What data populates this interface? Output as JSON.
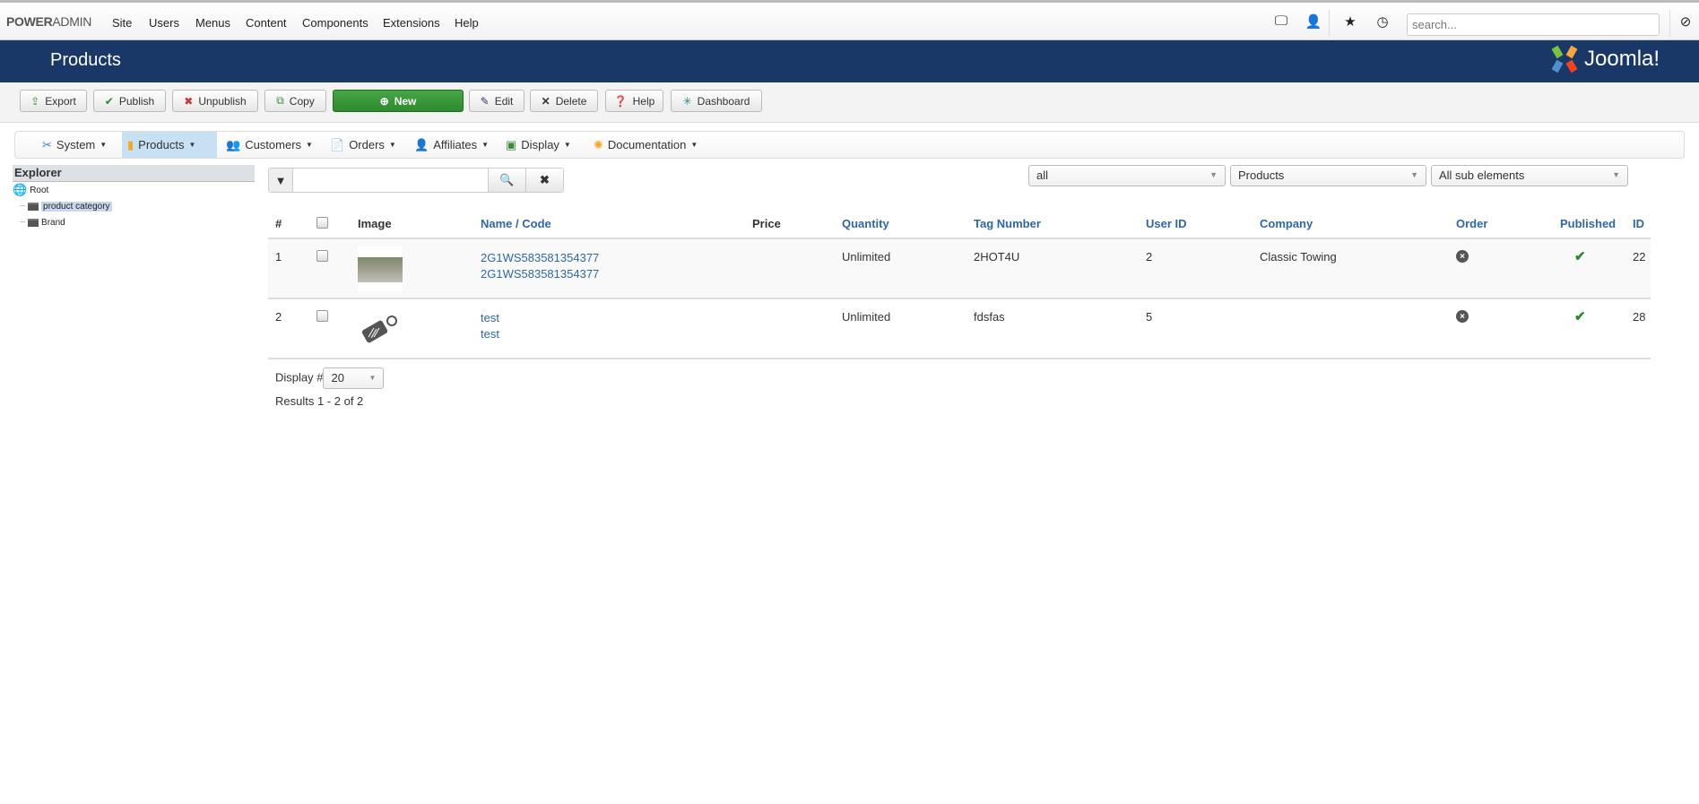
{
  "topnav": {
    "brand_bold": "POWER",
    "brand_rest": "ADMIN",
    "items": [
      "Site",
      "Users",
      "Menus",
      "Content",
      "Components",
      "Extensions",
      "Help"
    ],
    "search_placeholder": "search..."
  },
  "title": "Products",
  "logo_text": "Joomla!",
  "toolbar": {
    "export": "Export",
    "publish": "Publish",
    "unpublish": "Unpublish",
    "copy": "Copy",
    "new": "New",
    "edit": "Edit",
    "delete": "Delete",
    "help": "Help",
    "dashboard": "Dashboard"
  },
  "submenu": [
    "System",
    "Products",
    "Customers",
    "Orders",
    "Affiliates",
    "Display",
    "Documentation"
  ],
  "explorer": {
    "title": "Explorer",
    "root": "Root",
    "children": [
      "product category",
      "Brand"
    ]
  },
  "filters": {
    "status": "all",
    "type": "Products",
    "scope": "All sub elements"
  },
  "table": {
    "headers": {
      "num": "#",
      "image": "Image",
      "name": "Name / Code",
      "price": "Price",
      "quantity": "Quantity",
      "tag": "Tag Number",
      "user": "User ID",
      "company": "Company",
      "order": "Order",
      "published": "Published",
      "id": "ID"
    },
    "rows": [
      {
        "num": "1",
        "name": "2G1WS583581354377",
        "code": "2G1WS583581354377",
        "price": "",
        "quantity": "Unlimited",
        "tag": "2HOT4U",
        "user": "2",
        "company": "Classic Towing",
        "id": "22"
      },
      {
        "num": "2",
        "name": "test",
        "code": "test",
        "price": "",
        "quantity": "Unlimited",
        "tag": "fdsfas",
        "user": "5",
        "company": "",
        "id": "28"
      }
    ]
  },
  "footer": {
    "display_label": "Display #",
    "display_value": "20",
    "results": "Results 1 - 2 of 2"
  },
  "colors": {
    "brand": "#1a3867",
    "accent": "#2e67a5",
    "new": "#3c9a3c"
  }
}
